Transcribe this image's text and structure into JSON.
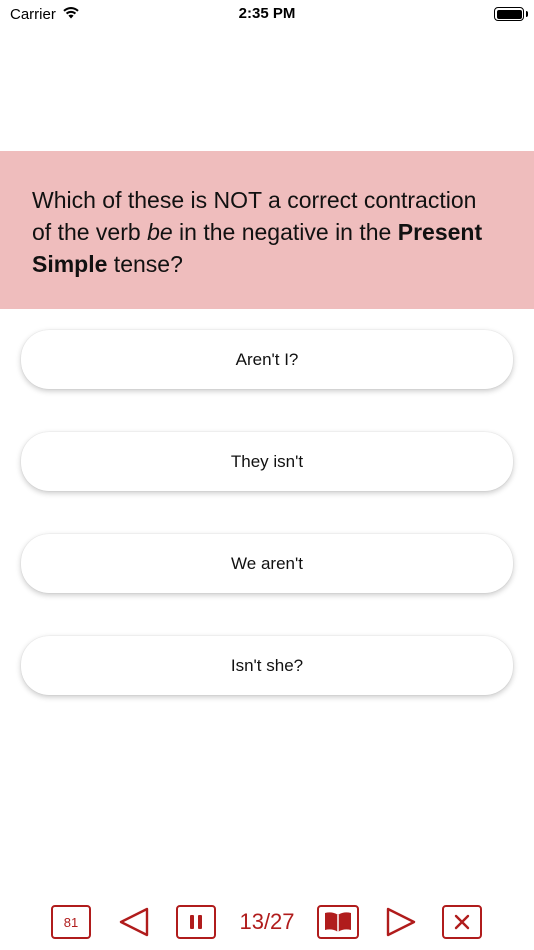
{
  "status_bar": {
    "carrier": "Carrier",
    "time": "2:35 PM",
    "wifi_icon": "wifi-icon",
    "battery_icon": "battery-icon"
  },
  "question": {
    "part1": "Which of these is NOT a correct contraction of the verb ",
    "italic": "be",
    "part2": " in the negative in the ",
    "bold": "Present Simple",
    "part3": " tense?"
  },
  "answers": [
    {
      "label": "Aren't I?"
    },
    {
      "label": "They isn't"
    },
    {
      "label": "We aren't"
    },
    {
      "label": "Isn't she?"
    }
  ],
  "toolbar": {
    "count": "81",
    "progress": "13/27",
    "icons": [
      "count-icon",
      "previous-triangle-icon",
      "pause-icon",
      "book-icon",
      "next-triangle-icon",
      "close-x-icon"
    ]
  },
  "colors": {
    "banner": "#efbdbd",
    "accent": "#b01c1c"
  }
}
